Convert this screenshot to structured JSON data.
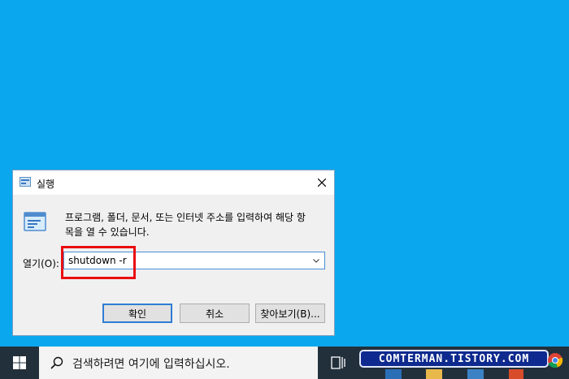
{
  "dialog": {
    "title": "실행",
    "description": "프로그램, 폴더, 문서, 또는 인터넷 주소를 입력하여 해당 항\n목을 열 수 있습니다.",
    "open_label": "열기(O):",
    "input_value": "shutdown -r",
    "ok_label": "확인",
    "cancel_label": "취소",
    "browse_label": "찾아보기(B)..."
  },
  "taskbar": {
    "search_placeholder": "검색하려면 여기에 입력하십시오.",
    "watermark": "COMTERMAN.TISTORY.COM"
  },
  "colors": {
    "desktop": "#0ba7ee",
    "taskbar": "#22303c",
    "highlight": "#ea0d10",
    "watermark_bg": "#0e2a8e"
  },
  "icons": [
    "run-icon",
    "close-icon",
    "dropdown-chevron-icon",
    "windows-start-icon",
    "search-icon",
    "task-view-icon",
    "chrome-icon"
  ]
}
